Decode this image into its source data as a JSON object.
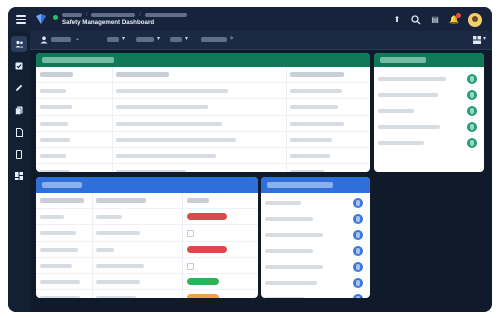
{
  "app": {
    "title": "Safety Management Dashboard",
    "crumb_count": 3
  },
  "colors": {
    "chrome_bg": "#0f1a2b",
    "header_green": "#0f7a5a",
    "header_blue": "#2f6fdb",
    "status_red": "#d94a4a",
    "status_green": "#2eb35a",
    "status_orange": "#f0a14a",
    "chip_green": "#22a07a",
    "chip_blue": "#3b78de"
  },
  "sidebar": {
    "items": [
      {
        "icon": "users-icon",
        "glyph": "👥",
        "active": true
      },
      {
        "icon": "checkbox-icon",
        "glyph": "☑",
        "active": false
      },
      {
        "icon": "pencil-icon",
        "glyph": "✎",
        "active": false
      },
      {
        "icon": "documents-icon",
        "glyph": "▤",
        "active": false
      },
      {
        "icon": "file-icon",
        "glyph": "▢",
        "active": false
      },
      {
        "icon": "tablet-icon",
        "glyph": "▯",
        "active": false
      },
      {
        "icon": "dashboard-icon",
        "glyph": "▦",
        "active": false
      }
    ]
  },
  "topbar": {
    "icons": [
      "up-arrow-icon",
      "search-icon",
      "chat-icon",
      "bell-icon",
      "avatar"
    ],
    "bell_has_badge": true
  },
  "toolbar": {
    "view_icon": "users-icon"
  },
  "panels": {
    "incidents": {
      "header_color": "#0f7a5a",
      "columns": 3,
      "rows": 6
    },
    "actions": {
      "header_color": "#0f7a5a",
      "items": 5
    },
    "inspections": {
      "header_color": "#2f6fdb",
      "statuses": [
        "red",
        "empty",
        "red",
        "empty",
        "green",
        "orange"
      ]
    },
    "team": {
      "header_color": "#2f6fdb",
      "items": 7
    }
  }
}
